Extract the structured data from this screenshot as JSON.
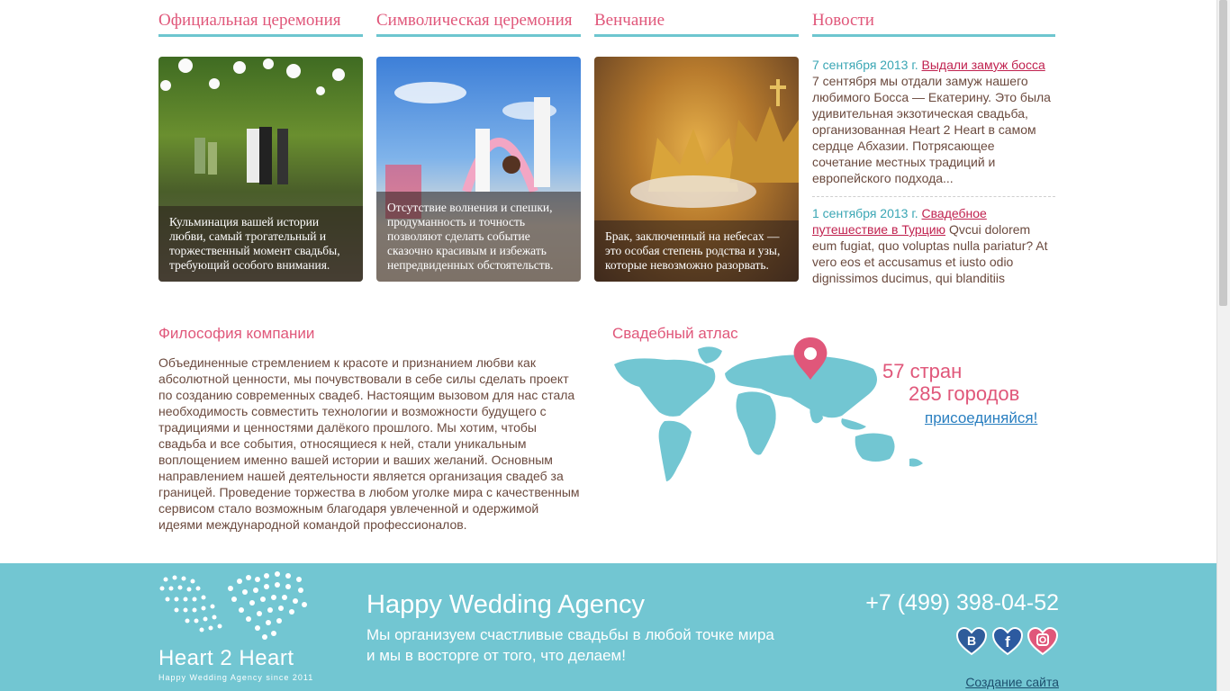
{
  "columns": [
    {
      "title": "Официальная церемония",
      "caption": "Кульминация вашей истории любви, самый трогательный и торжественный момент свадьбы, требующий особого внимания."
    },
    {
      "title": "Символическая церемония",
      "caption": "Отсутствие волнения и спешки, продуманность и точность позволяют сделать событие сказочно красивым и избежать непредвиденных обстоятельств."
    },
    {
      "title": "Венчание",
      "caption": "Брак, заключенный на небесах — это особая степень родства и узы, которые невозможно разорвать."
    }
  ],
  "news": {
    "title": "Новости",
    "items": [
      {
        "date": "7 сентября 2013 г.",
        "link": "Выдали замуж босса",
        "text": "7 сентября мы отдали замуж нашего любимого Босса — Екатерину. Это была удивительная экзотическая свадьба, организованная Heart 2 Heart в самом сердце Абхазии. Потрясающее сочетание местных традиций и европейского подхода..."
      },
      {
        "date": "1 сентября 2013 г.",
        "link": "Свадебное путешествие в Турцию",
        "text": "Qvcui dolorem eum fugiat, quo voluptas nulla pariatur? At vero eos et accusamus et iusto odio dignissimos ducimus, qui blanditiis"
      }
    ]
  },
  "philosophy": {
    "title": "Философия компании",
    "text": "Объединенные стремлением к красоте и признанием любви как абсолютной ценности, мы почувствовали в себе силы сделать проект по созданию современных свадеб. Настоящим вызовом для нас стала необходимость совместить технологии и возможности будущего с традициями и ценностями далёкого прошлого. Мы хотим, чтобы свадьба и все события, относящиеся к ней, стали уникальным воплощением именно вашей истории и ваших желаний. Основным направлением нашей деятельности является организация свадеб за границей. Проведение торжества в любом уголке мира с качественным сервисом стало возможным благодаря увлеченной и одержимой идеями международной командой профессионалов."
  },
  "atlas": {
    "title": "Свадебный атлас",
    "countries": "57 стран",
    "cities": "285 городов",
    "join": "присоединяйся!"
  },
  "footer": {
    "logo_text": "Heart 2 Heart",
    "logo_sub": "Happy Wedding Agency since 2011",
    "agency": "Happy Wedding Agency",
    "tagline": "Мы организуем счастливые свадьбы в любой точке мира и мы в восторге от того, что делаем!",
    "phone": "+7 (499) 398-04-52",
    "social": [
      "vk-icon",
      "facebook-icon",
      "instagram-icon"
    ],
    "create_site": "Создание сайта"
  },
  "colors": {
    "accent": "#e0577a",
    "teal": "#72c6d2",
    "text": "#6b4a3e",
    "link": "#c0224f"
  }
}
